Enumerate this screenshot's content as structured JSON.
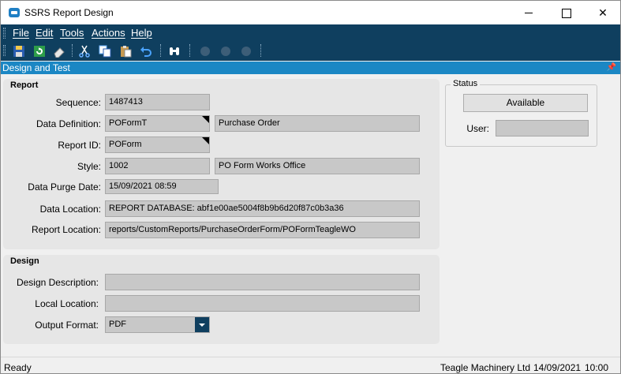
{
  "window": {
    "title": "SSRS Report Design"
  },
  "menu": [
    "File",
    "Edit",
    "Tools",
    "Actions",
    "Help"
  ],
  "toolbar": {
    "icons": [
      "save-icon",
      "refresh-icon",
      "eraser-icon",
      "cut-icon",
      "copy-icon",
      "paste-icon",
      "undo-icon",
      "find-icon",
      "first-record-icon",
      "previous-record-icon",
      "next-record-icon"
    ]
  },
  "panel": {
    "title": "Design and Test"
  },
  "report": {
    "heading": "Report",
    "sequence_label": "Sequence:",
    "sequence": "1487413",
    "data_definition_label": "Data Definition:",
    "data_definition_code": "POFormT",
    "data_definition_desc": "Purchase Order",
    "report_id_label": "Report ID:",
    "report_id": "POForm",
    "style_label": "Style:",
    "style_code": "1002",
    "style_desc": "PO Form Works Office",
    "purge_label": "Data Purge Date:",
    "purge_date": "15/09/2021 08:59",
    "data_location_label": "Data Location:",
    "data_location": "REPORT DATABASE: abf1e00ae5004f8b9b6d20f87c0b3a36",
    "report_location_label": "Report Location:",
    "report_location": "reports/CustomReports/PurchaseOrderForm/POFormTeagleWO"
  },
  "design": {
    "heading": "Design",
    "description_label": "Design Description:",
    "description": "",
    "local_location_label": "Local Location:",
    "local_location": "",
    "output_format_label": "Output Format:",
    "output_format": "PDF"
  },
  "status": {
    "heading": "Status",
    "state": "Available",
    "user_label": "User:",
    "user": ""
  },
  "statusbar": {
    "state": "Ready",
    "company": "Teagle Machinery Ltd",
    "date": "14/09/2021",
    "time": "10:00"
  },
  "colors": {
    "nav_bg": "#0f3f5f",
    "panel_header": "#1b87c4",
    "field_bg": "#c8c8c8",
    "group_bg": "#e6e6e6"
  }
}
